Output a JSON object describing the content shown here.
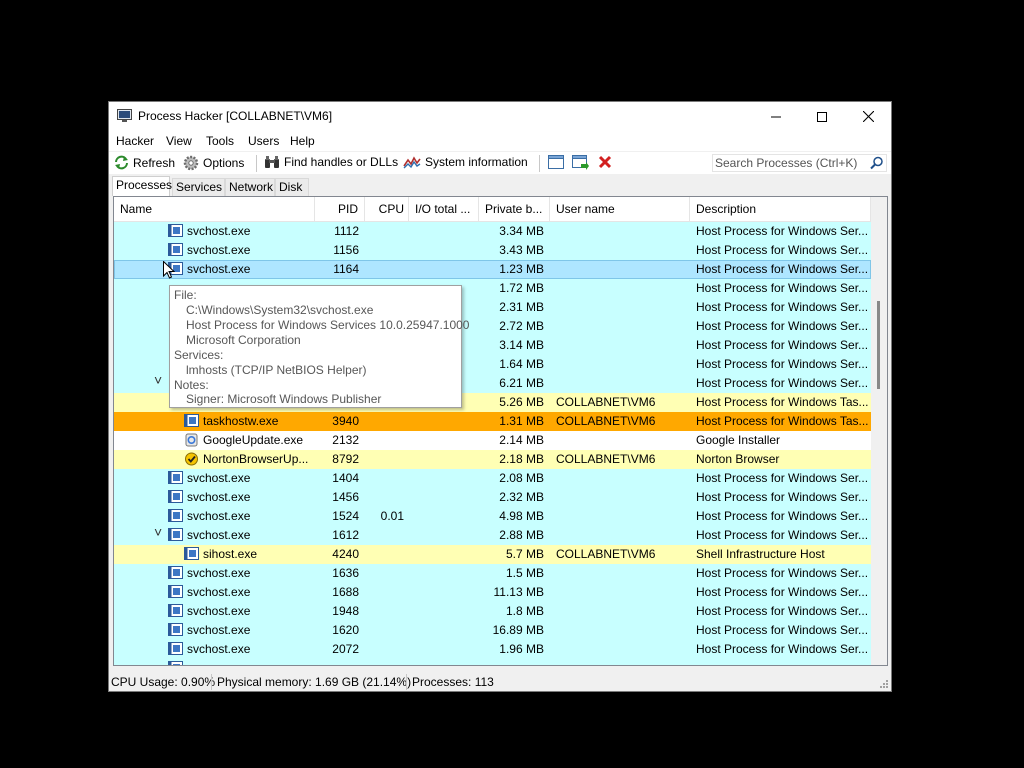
{
  "window": {
    "title": "Process Hacker [COLLABNET\\VM6]",
    "minimize_icon": "minimize-icon",
    "maximize_icon": "maximize-icon",
    "close_icon": "close-icon"
  },
  "menu": [
    "Hacker",
    "View",
    "Tools",
    "Users",
    "Help"
  ],
  "toolbar": {
    "refresh": "Refresh",
    "options": "Options",
    "find_handles": "Find handles or DLLs",
    "system_info": "System information",
    "search_placeholder": "Search Processes (Ctrl+K)"
  },
  "tabs": [
    "Processes",
    "Services",
    "Network",
    "Disk"
  ],
  "columns": [
    "Name",
    "PID",
    "CPU",
    "I/O total ...",
    "Private b...",
    "User name",
    "Description"
  ],
  "colors": {
    "service_row": "#c8ffff",
    "user_row": "#ffffb4",
    "selected_row": "#aee6ff",
    "highlight_row": "#ffa800"
  },
  "rows": [
    {
      "name": "svchost.exe",
      "pid": "1112",
      "cpu": "",
      "io": "",
      "private": "3.34 MB",
      "user": "",
      "desc": "Host Process for Windows Ser...",
      "indent": 1,
      "kind": "service",
      "icon": "service-icon",
      "expand": false
    },
    {
      "name": "svchost.exe",
      "pid": "1156",
      "cpu": "",
      "io": "",
      "private": "3.43 MB",
      "user": "",
      "desc": "Host Process for Windows Ser...",
      "indent": 1,
      "kind": "service",
      "icon": "service-icon",
      "expand": false
    },
    {
      "name": "svchost.exe",
      "pid": "1164",
      "cpu": "",
      "io": "",
      "private": "1.23 MB",
      "user": "",
      "desc": "Host Process for Windows Ser...",
      "indent": 1,
      "kind": "selected",
      "icon": "service-icon",
      "expand": false
    },
    {
      "name": "",
      "pid": "",
      "cpu": "",
      "io": "",
      "private": "1.72 MB",
      "user": "",
      "desc": "Host Process for Windows Ser...",
      "indent": 1,
      "kind": "service",
      "icon": "",
      "expand": false
    },
    {
      "name": "",
      "pid": "",
      "cpu": "",
      "io": "",
      "private": "2.31 MB",
      "user": "",
      "desc": "Host Process for Windows Ser...",
      "indent": 1,
      "kind": "service",
      "icon": "",
      "expand": false
    },
    {
      "name": "",
      "pid": "",
      "cpu": "",
      "io": "",
      "private": "2.72 MB",
      "user": "",
      "desc": "Host Process for Windows Ser...",
      "indent": 1,
      "kind": "service",
      "icon": "",
      "expand": false
    },
    {
      "name": "",
      "pid": "",
      "cpu": "",
      "io": "",
      "private": "3.14 MB",
      "user": "",
      "desc": "Host Process for Windows Ser...",
      "indent": 1,
      "kind": "service",
      "icon": "",
      "expand": false
    },
    {
      "name": "",
      "pid": "",
      "cpu": "",
      "io": "",
      "private": "1.64 MB",
      "user": "",
      "desc": "Host Process for Windows Ser...",
      "indent": 1,
      "kind": "service",
      "icon": "",
      "expand": false
    },
    {
      "name": "",
      "pid": "",
      "cpu": "",
      "io": "",
      "private": "6.21 MB",
      "user": "",
      "desc": "Host Process for Windows Ser...",
      "indent": 1,
      "kind": "service",
      "icon": "",
      "expand": true
    },
    {
      "name": "",
      "pid": "",
      "cpu": "",
      "io": "",
      "private": "5.26 MB",
      "user": "COLLABNET\\VM6",
      "desc": "Host Process for Windows Tas...",
      "indent": 2,
      "kind": "user",
      "icon": "",
      "expand": false
    },
    {
      "name": "taskhostw.exe",
      "pid": "3940",
      "cpu": "",
      "io": "",
      "private": "1.31 MB",
      "user": "COLLABNET\\VM6",
      "desc": "Host Process for Windows Tas...",
      "indent": 2,
      "kind": "highlight",
      "icon": "service-icon",
      "expand": false
    },
    {
      "name": "GoogleUpdate.exe",
      "pid": "2132",
      "cpu": "",
      "io": "",
      "private": "2.14 MB",
      "user": "",
      "desc": "Google Installer",
      "indent": 2,
      "kind": "plain",
      "icon": "google-update-icon",
      "expand": false
    },
    {
      "name": "NortonBrowserUp...",
      "pid": "8792",
      "cpu": "",
      "io": "",
      "private": "2.18 MB",
      "user": "COLLABNET\\VM6",
      "desc": "Norton Browser",
      "indent": 2,
      "kind": "user",
      "icon": "norton-icon",
      "expand": false
    },
    {
      "name": "svchost.exe",
      "pid": "1404",
      "cpu": "",
      "io": "",
      "private": "2.08 MB",
      "user": "",
      "desc": "Host Process for Windows Ser...",
      "indent": 1,
      "kind": "service",
      "icon": "service-icon",
      "expand": false
    },
    {
      "name": "svchost.exe",
      "pid": "1456",
      "cpu": "",
      "io": "",
      "private": "2.32 MB",
      "user": "",
      "desc": "Host Process for Windows Ser...",
      "indent": 1,
      "kind": "service",
      "icon": "service-icon",
      "expand": false
    },
    {
      "name": "svchost.exe",
      "pid": "1524",
      "cpu": "0.01",
      "io": "",
      "private": "4.98 MB",
      "user": "",
      "desc": "Host Process for Windows Ser...",
      "indent": 1,
      "kind": "service",
      "icon": "service-icon",
      "expand": false
    },
    {
      "name": "svchost.exe",
      "pid": "1612",
      "cpu": "",
      "io": "",
      "private": "2.88 MB",
      "user": "",
      "desc": "Host Process for Windows Ser...",
      "indent": 1,
      "kind": "service",
      "icon": "service-icon",
      "expand": true
    },
    {
      "name": "sihost.exe",
      "pid": "4240",
      "cpu": "",
      "io": "",
      "private": "5.7 MB",
      "user": "COLLABNET\\VM6",
      "desc": "Shell Infrastructure Host",
      "indent": 2,
      "kind": "user",
      "icon": "service-icon",
      "expand": false
    },
    {
      "name": "svchost.exe",
      "pid": "1636",
      "cpu": "",
      "io": "",
      "private": "1.5 MB",
      "user": "",
      "desc": "Host Process for Windows Ser...",
      "indent": 1,
      "kind": "service",
      "icon": "service-icon",
      "expand": false
    },
    {
      "name": "svchost.exe",
      "pid": "1688",
      "cpu": "",
      "io": "",
      "private": "11.13 MB",
      "user": "",
      "desc": "Host Process for Windows Ser...",
      "indent": 1,
      "kind": "service",
      "icon": "service-icon",
      "expand": false
    },
    {
      "name": "svchost.exe",
      "pid": "1948",
      "cpu": "",
      "io": "",
      "private": "1.8 MB",
      "user": "",
      "desc": "Host Process for Windows Ser...",
      "indent": 1,
      "kind": "service",
      "icon": "service-icon",
      "expand": false
    },
    {
      "name": "svchost.exe",
      "pid": "1620",
      "cpu": "",
      "io": "",
      "private": "16.89 MB",
      "user": "",
      "desc": "Host Process for Windows Ser...",
      "indent": 1,
      "kind": "service",
      "icon": "service-icon",
      "expand": false
    },
    {
      "name": "svchost.exe",
      "pid": "2072",
      "cpu": "",
      "io": "",
      "private": "1.96 MB",
      "user": "",
      "desc": "Host Process for Windows Ser...",
      "indent": 1,
      "kind": "service",
      "icon": "service-icon",
      "expand": false
    },
    {
      "name": "",
      "pid": "",
      "cpu": "",
      "io": "",
      "private": "",
      "user": "",
      "desc": "",
      "indent": 1,
      "kind": "service",
      "icon": "service-icon",
      "expand": false
    }
  ],
  "tooltip": {
    "file_label": "File:",
    "file_path": "C:\\Windows\\System32\\svchost.exe",
    "file_desc": "Host Process for Windows Services 10.0.25947.1000",
    "company": "Microsoft Corporation",
    "services_label": "Services:",
    "service": "lmhosts (TCP/IP NetBIOS Helper)",
    "notes_label": "Notes:",
    "signer": "Signer: Microsoft Windows Publisher"
  },
  "status": {
    "cpu": "CPU Usage: 0.90%",
    "memory": "Physical memory: 1.69 GB (21.14%)",
    "processes": "Processes: 113"
  }
}
